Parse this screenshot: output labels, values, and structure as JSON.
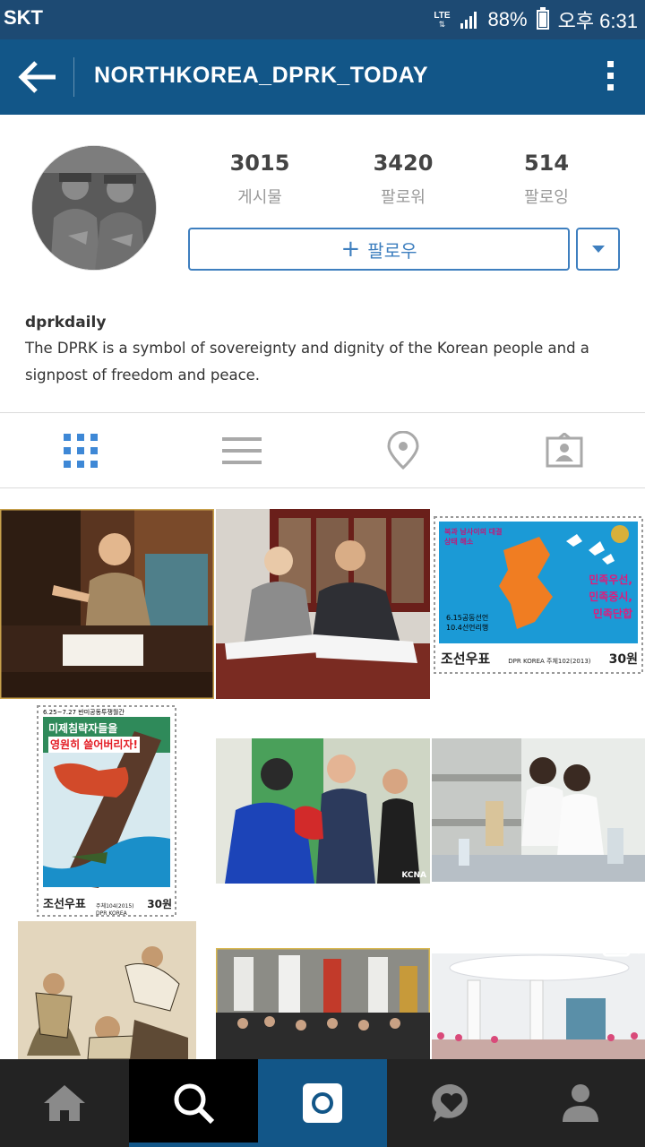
{
  "status_bar": {
    "carrier": "SKT",
    "network": "LTE",
    "battery": "88%",
    "battery_level": 0.88,
    "time": "오후 6:31"
  },
  "app_bar": {
    "title": "NORTHKOREA_DPRK_TODAY",
    "back_icon": "arrow-left-icon",
    "menu_icon": "more-vert-icon"
  },
  "profile": {
    "stats": [
      {
        "value": "3015",
        "label": "게시물"
      },
      {
        "value": "3420",
        "label": "팔로워"
      },
      {
        "value": "514",
        "label": "팔로잉"
      }
    ],
    "follow_button": "팔로우",
    "follow_plus": "+",
    "username": "dprkdaily",
    "bio": "The DPRK is a symbol of sovereignty and dignity of the Korean people and a signpost of freedom and peace."
  },
  "view_tabs": [
    {
      "name": "grid",
      "icon": "grid-icon",
      "active": true
    },
    {
      "name": "list",
      "icon": "list-icon",
      "active": false
    },
    {
      "name": "location",
      "icon": "location-pin-icon",
      "active": false
    },
    {
      "name": "tagged",
      "icon": "tagged-person-icon",
      "active": false
    }
  ],
  "photos": {
    "stamp1": {
      "top_text": "북과 남사이의 대결상태 해소",
      "slogan": [
        "민족우선,",
        "민족중시,",
        "민족단합"
      ],
      "dates": [
        "6.15공동선언",
        "10.4선언리행"
      ],
      "footer_left": "조선우표",
      "footer_mid": "DPR KOREA 주체102(2013)",
      "footer_value": "30원"
    },
    "stamp2": {
      "top_text": "6.25~7.27 반미공동투쟁월간",
      "slogan": [
        "미제침략자들을",
        "영원히 쓸어버리자!"
      ],
      "footer_left": "조선우표",
      "footer_mid": "주체104(2015) DPR KOREA",
      "footer_value": "30원"
    },
    "watermark": "KCNA",
    "video_icon": "video-camera-icon"
  },
  "colors": {
    "status_bar": "#1d4a73",
    "app_bar": "#125688",
    "accent": "#3e7fbf",
    "bottom_nav": "#232323"
  },
  "bottom_nav": [
    {
      "name": "home",
      "icon": "home-icon"
    },
    {
      "name": "search",
      "icon": "search-icon"
    },
    {
      "name": "camera",
      "icon": "camera-icon"
    },
    {
      "name": "activity",
      "icon": "heart-bubble-icon"
    },
    {
      "name": "profile",
      "icon": "person-icon"
    }
  ]
}
